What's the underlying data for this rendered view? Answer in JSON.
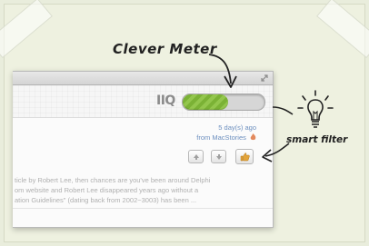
{
  "annotations": {
    "meter_caption": "Clever Meter",
    "filter_caption": "smart filter"
  },
  "window": {
    "iq_label": "IIQ",
    "meter_level": 0.55,
    "item": {
      "age": "5 day(s) ago",
      "source": "from MacStories",
      "snippet_lines": [
        "ticle by Robert Lee, then chances are you've been around Delphi",
        "om website and Robert Lee disappeared years ago without a",
        "ation Guidelines\" (dating back from 2002~3003) has been ..."
      ]
    }
  },
  "icons": {
    "resize": "resize-icon",
    "flame": "flame-icon",
    "up": "arrow-up-icon",
    "down": "arrow-down-icon",
    "like": "thumbs-up-icon",
    "bulb": "light-bulb-icon"
  },
  "colors": {
    "meter_green": "#86bd3f",
    "link_blue": "#6c8fbf"
  }
}
